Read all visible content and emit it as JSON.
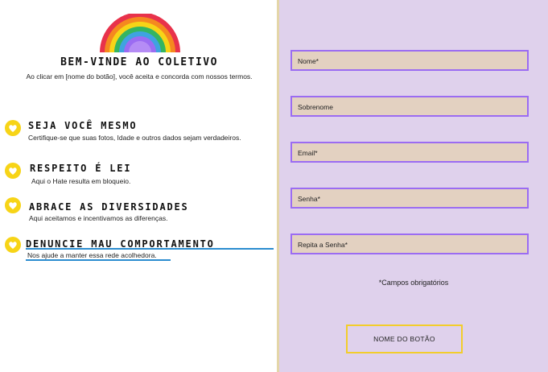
{
  "header": {
    "title": "BEM-VINDE AO COLETIVO",
    "subtitle": "Ao clicar em [nome do botão], você aceita e concorda com nossos termos."
  },
  "rules": [
    {
      "title": "SEJA VOCÊ MESMO",
      "description": "Certifique-se que suas fotos, Idade e outros dados sejam verdadeiros."
    },
    {
      "title": "RESPEITO É LEI",
      "description": "Aqui o Hate resulta em bloqueio."
    },
    {
      "title": "ABRACE AS DIVERSIDADES",
      "description": "Aqui aceitamos e incentivamos as diferenças."
    },
    {
      "title": "DENUNCIE MAU COMPORTAMENTO",
      "description": "Nos ajude a manter essa rede acolhedora."
    }
  ],
  "form": {
    "fields": [
      {
        "placeholder": "Nome*"
      },
      {
        "placeholder": "Sobrenome"
      },
      {
        "placeholder": "Email*"
      },
      {
        "placeholder": "Senha*"
      },
      {
        "placeholder": "Repita a Senha*"
      }
    ],
    "required_note": "*Campos obrigatórios",
    "submit_label": "NOME DO BOTÃO"
  },
  "colors": {
    "panel_background": "#dfd1ec",
    "field_border": "#9b6cf2",
    "field_fill": "#e3d1c1",
    "button_border": "#f2cd2b",
    "heart_fill": "#f7d417",
    "accent_underline": "#2b8ccf"
  },
  "icons": {
    "logo": "rainbow-icon",
    "bullet": "heart-icon"
  }
}
